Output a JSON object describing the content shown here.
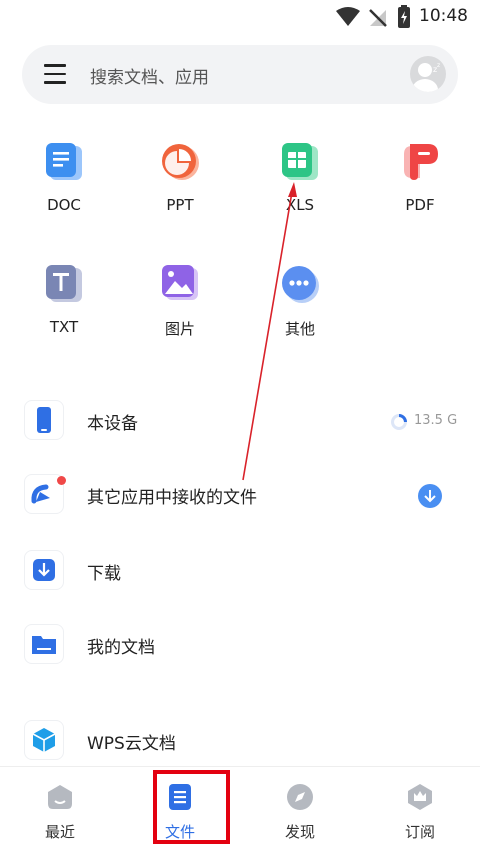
{
  "status_bar": {
    "time": "10:48"
  },
  "search": {
    "placeholder": "搜索文档、应用"
  },
  "file_types": [
    {
      "label": "DOC"
    },
    {
      "label": "PPT"
    },
    {
      "label": "XLS"
    },
    {
      "label": "PDF"
    },
    {
      "label": "TXT"
    },
    {
      "label": "图片"
    },
    {
      "label": "其他"
    }
  ],
  "locations": [
    {
      "label": "本设备",
      "storage": "13.5 G"
    },
    {
      "label": "其它应用中接收的文件"
    },
    {
      "label": "下载"
    },
    {
      "label": "我的文档"
    },
    {
      "label": "WPS云文档"
    }
  ],
  "bottom_nav": [
    {
      "label": "最近"
    },
    {
      "label": "文件"
    },
    {
      "label": "发现"
    },
    {
      "label": "订阅"
    }
  ],
  "colors": {
    "accent": "#2f6fe4",
    "highlight": "#e30010"
  }
}
